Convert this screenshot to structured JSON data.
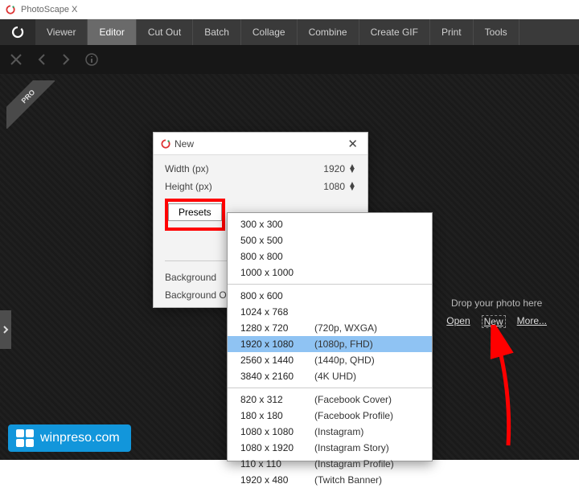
{
  "app": {
    "title": "PhotoScape X"
  },
  "tabs": [
    "Viewer",
    "Editor",
    "Cut Out",
    "Batch",
    "Collage",
    "Combine",
    "Create GIF",
    "Print",
    "Tools"
  ],
  "active_tab_index": 1,
  "pro_ribbon": "PRO",
  "drop": {
    "hint": "Drop your photo here",
    "links": {
      "open": "Open",
      "new": "New",
      "more": "More..."
    }
  },
  "dialog": {
    "title": "New",
    "width_label": "Width (px)",
    "width_value": "1920",
    "height_label": "Height (px)",
    "height_value": "1080",
    "presets_button": "Presets",
    "bg_color_label": "Background",
    "bg_opacity_label": "Background Opacity"
  },
  "presets": {
    "groups": [
      [
        {
          "dim": "300 x 300",
          "note": ""
        },
        {
          "dim": "500 x 500",
          "note": ""
        },
        {
          "dim": "800 x 800",
          "note": ""
        },
        {
          "dim": "1000 x 1000",
          "note": ""
        }
      ],
      [
        {
          "dim": "800 x 600",
          "note": ""
        },
        {
          "dim": "1024 x 768",
          "note": ""
        },
        {
          "dim": "1280 x 720",
          "note": "(720p, WXGA)"
        },
        {
          "dim": "1920 x 1080",
          "note": "(1080p, FHD)",
          "selected": true
        },
        {
          "dim": "2560 x 1440",
          "note": "(1440p, QHD)"
        },
        {
          "dim": "3840 x 2160",
          "note": "(4K UHD)"
        }
      ],
      [
        {
          "dim": "820 x 312",
          "note": "(Facebook Cover)"
        },
        {
          "dim": "180 x 180",
          "note": "(Facebook Profile)"
        },
        {
          "dim": "1080 x 1080",
          "note": "(Instagram)"
        },
        {
          "dim": "1080 x 1920",
          "note": "(Instagram Story)"
        },
        {
          "dim": "110 x 110",
          "note": "(Instagram Profile)"
        },
        {
          "dim": "1920 x 480",
          "note": "(Twitch Banner)"
        }
      ]
    ]
  },
  "watermark": "winpreso.com",
  "colors": {
    "highlight": "#f00",
    "brand": "#1296db",
    "selection": "#8fc3f3"
  }
}
